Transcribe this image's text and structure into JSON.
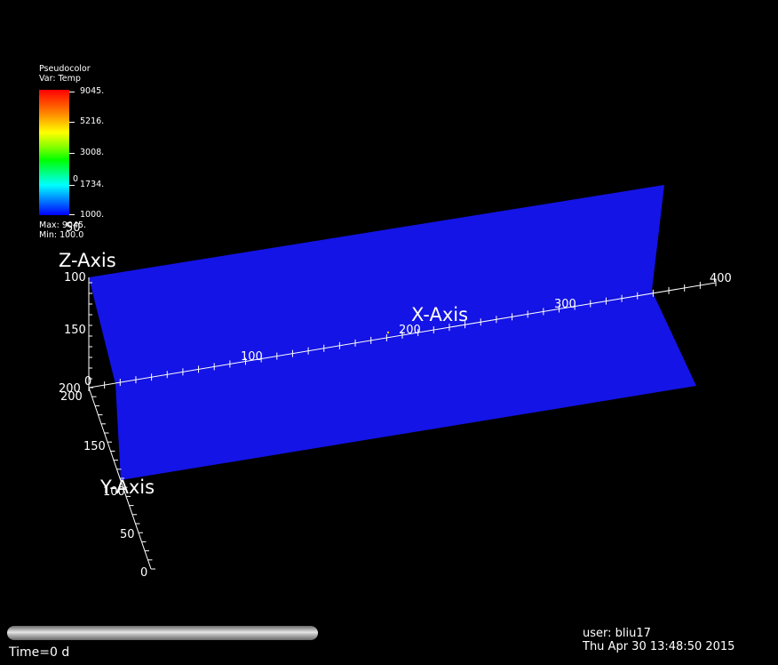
{
  "legend": {
    "title_line1": "Pseudocolor",
    "title_line2": "Var: Temp",
    "ticks": [
      "9045.",
      "5216.",
      "3008.",
      "1734.",
      "1000."
    ],
    "overlap_glyph": "0",
    "max_text": "Max: 9045.",
    "min_text": "Min: 100.0",
    "colors": [
      "#ff0000",
      "#ff8000",
      "#ffff00",
      "#00ff00",
      "#00ffff",
      "#0000ff"
    ]
  },
  "scene": {
    "surface_color": "#1414e6",
    "background": "#000000",
    "x_axis": {
      "title": "X-Axis",
      "ticks": [
        "0",
        "100",
        "200",
        "300",
        "400"
      ]
    },
    "y_axis": {
      "title": "Y-Axis",
      "ticks": [
        "200",
        "150",
        "100",
        "50",
        "0"
      ]
    },
    "z_axis": {
      "title": "Z-Axis",
      "ticks": [
        "200",
        "150",
        "100",
        "50"
      ]
    }
  },
  "footer": {
    "time_label": "Time=0 d",
    "user": "user: bliu17",
    "datetime": "Thu Apr 30 13:48:50 2015"
  }
}
